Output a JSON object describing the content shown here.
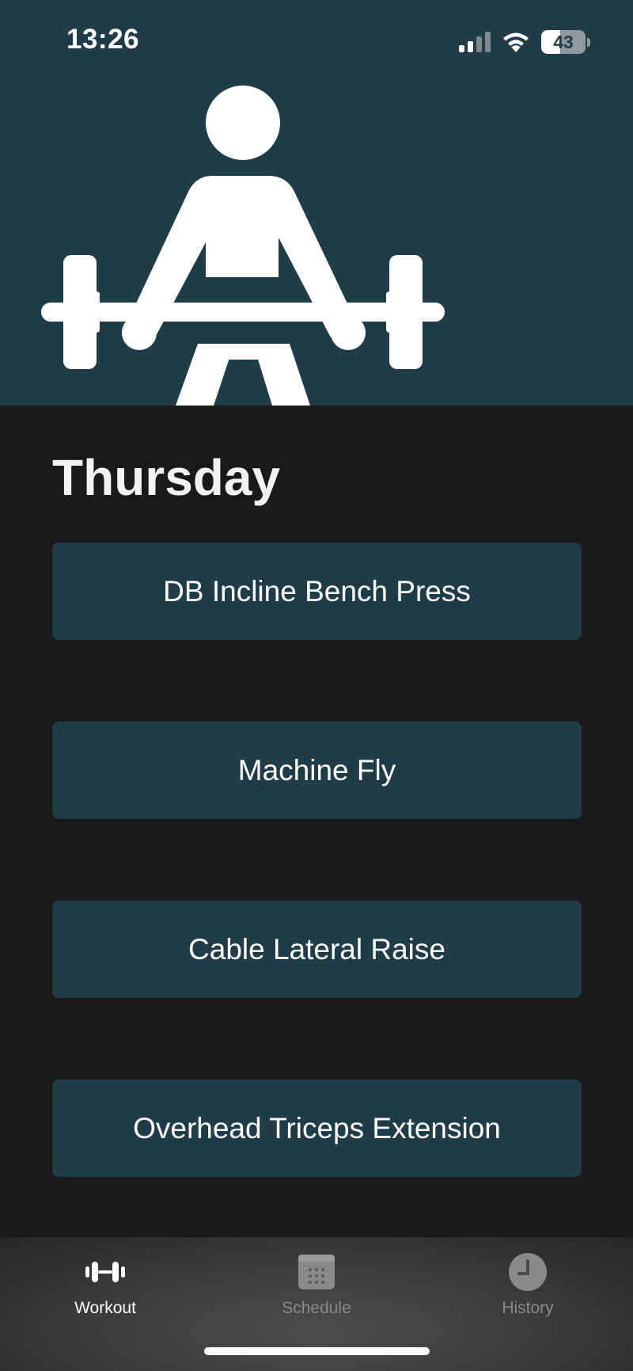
{
  "status_bar": {
    "time": "13:26",
    "battery_level": "43",
    "battery_fraction": 0.43,
    "icons": [
      "cellular-signal-icon",
      "wifi-icon",
      "battery-icon"
    ]
  },
  "hero": {
    "illustration": "weightlifter-icon",
    "background_color": "#1f3c48"
  },
  "main": {
    "day_title": "Thursday",
    "exercises": [
      {
        "label": "DB Incline Bench Press"
      },
      {
        "label": "Machine Fly"
      },
      {
        "label": "Cable Lateral Raise"
      },
      {
        "label": "Overhead Triceps Extension"
      }
    ]
  },
  "tab_bar": {
    "tabs": [
      {
        "label": "Workout",
        "icon": "dumbbell-icon",
        "active": true
      },
      {
        "label": "Schedule",
        "icon": "calendar-icon",
        "active": false
      },
      {
        "label": "History",
        "icon": "clock-icon",
        "active": false
      }
    ]
  },
  "colors": {
    "accent": "#1f3c48",
    "background": "#19191b",
    "text": "#ffffff",
    "inactive_tab": "#8a8a8a"
  }
}
